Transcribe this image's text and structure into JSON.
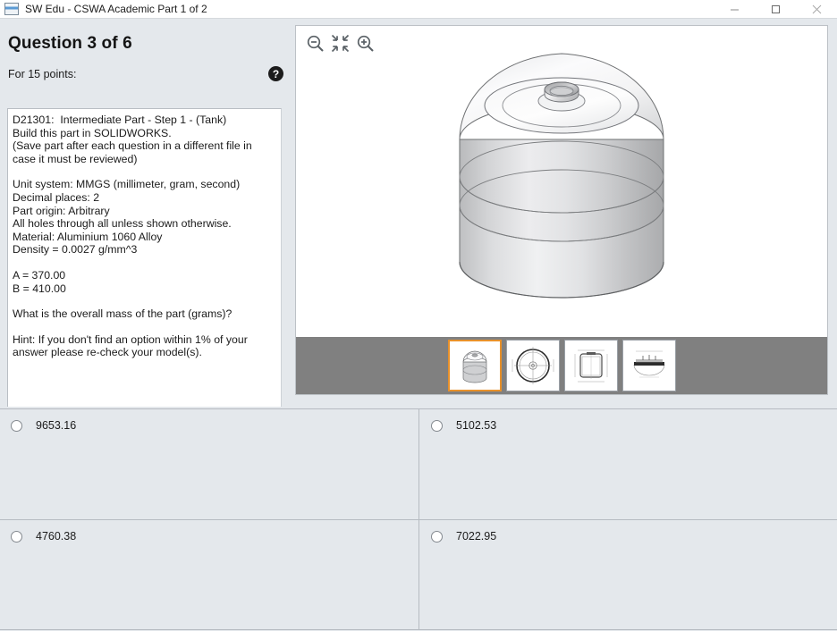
{
  "window": {
    "title": "SW Edu - CSWA Academic Part 1 of 2",
    "app_icon": "solidworks-icon",
    "minimize_label": "Minimize",
    "maximize_label": "Maximize",
    "close_label": "Close"
  },
  "question": {
    "heading": "Question 3 of 6",
    "points_label": "For 15 points:",
    "help_glyph": "?",
    "body_part1": "D21301:  Intermediate Part - Step 1 - (Tank)\nBuild this part in SOLIDWORKS.\n(Save part after each question in a different file in case it must be reviewed)",
    "body_part2": "Unit system: MMGS (millimeter, gram, second)\nDecimal places: 2\nPart origin: Arbitrary\nAll holes through all unless shown otherwise.\nMaterial: Aluminium 1060 Alloy\nDensity = 0.0027 g/mm^3",
    "body_part3": "A = 370.00\nB = 410.00",
    "body_part4": "What is the overall mass of the part (grams)?",
    "body_part5": "Hint: If you don't find an option within 1% of your answer please re-check your model(s)."
  },
  "viewer": {
    "toolbar": [
      {
        "name": "zoom-out-icon",
        "label": "Zoom Out"
      },
      {
        "name": "zoom-to-fit-icon",
        "label": "Zoom to Fit"
      },
      {
        "name": "zoom-in-icon",
        "label": "Zoom In"
      }
    ],
    "model_name": "tank-isometric-view",
    "thumbnails": [
      {
        "name": "thumbnail-isometric",
        "selected": true
      },
      {
        "name": "thumbnail-top-view",
        "selected": false
      },
      {
        "name": "thumbnail-front-section-drawing",
        "selected": false
      },
      {
        "name": "thumbnail-bottom-section-drawing",
        "selected": false
      }
    ]
  },
  "answers": {
    "options": [
      {
        "value": "9653.16",
        "selected": false
      },
      {
        "value": "5102.53",
        "selected": false
      },
      {
        "value": "4760.38",
        "selected": false
      },
      {
        "value": "7022.95",
        "selected": false
      }
    ]
  },
  "colors": {
    "accent_selected": "#e8912a",
    "panel_bg": "#e4e8ec",
    "viewer_bg": "#ffffff",
    "thumbstrip_bg": "#808080"
  }
}
